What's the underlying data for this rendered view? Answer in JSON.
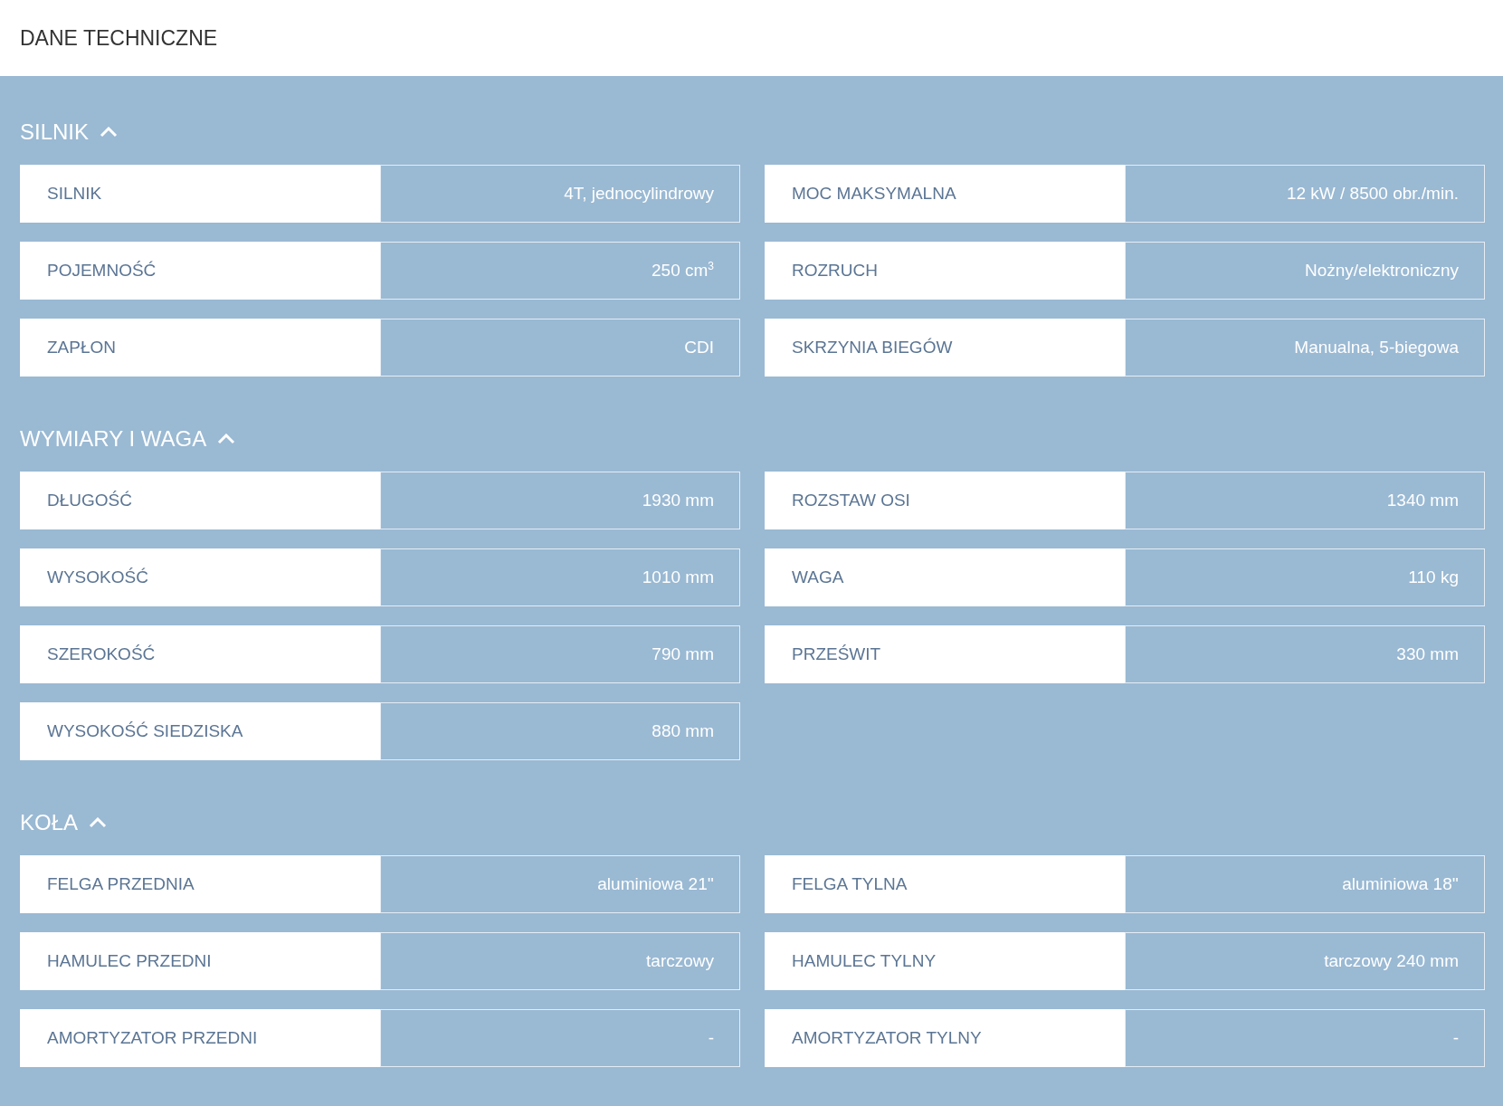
{
  "title": "DANE TECHNICZNE",
  "sections": [
    {
      "title": "SILNIK",
      "expanded": true,
      "specs": [
        {
          "label": "SILNIK",
          "value": "4T, jednocylindrowy"
        },
        {
          "label": "MOC MAKSYMALNA",
          "value": "12 kW / 8500 obr./min."
        },
        {
          "label": "POJEMNOŚĆ",
          "value": "250 cm$^{3}$"
        },
        {
          "label": "ROZRUCH",
          "value": "Nożny/elektroniczny"
        },
        {
          "label": "ZAPŁON",
          "value": "CDI"
        },
        {
          "label": "SKRZYNIA BIEGÓW",
          "value": "Manualna, 5-biegowa"
        }
      ]
    },
    {
      "title": "WYMIARY I WAGA",
      "expanded": true,
      "specs": [
        {
          "label": "DŁUGOŚĆ",
          "value": "1930 mm"
        },
        {
          "label": "ROZSTAW OSI",
          "value": "1340 mm"
        },
        {
          "label": "WYSOKOŚĆ",
          "value": "1010 mm"
        },
        {
          "label": "WAGA",
          "value": "110 kg"
        },
        {
          "label": "SZEROKOŚĆ",
          "value": "790 mm"
        },
        {
          "label": "PRZEŚWIT",
          "value": "330 mm"
        },
        {
          "label": "WYSOKOŚĆ SIEDZISKA",
          "value": "880 mm"
        }
      ]
    },
    {
      "title": "KOŁA",
      "expanded": true,
      "specs": [
        {
          "label": "FELGA PRZEDNIA",
          "value": "aluminiowa 21''"
        },
        {
          "label": "FELGA TYLNA",
          "value": "aluminiowa 18''"
        },
        {
          "label": "HAMULEC PRZEDNI",
          "value": "tarczowy"
        },
        {
          "label": "HAMULEC TYLNY",
          "value": "tarczowy 240 mm"
        },
        {
          "label": "AMORTYZATOR PRZEDNI",
          "value": "-"
        },
        {
          "label": "AMORTYZATOR TYLNY",
          "value": "-"
        }
      ]
    }
  ]
}
